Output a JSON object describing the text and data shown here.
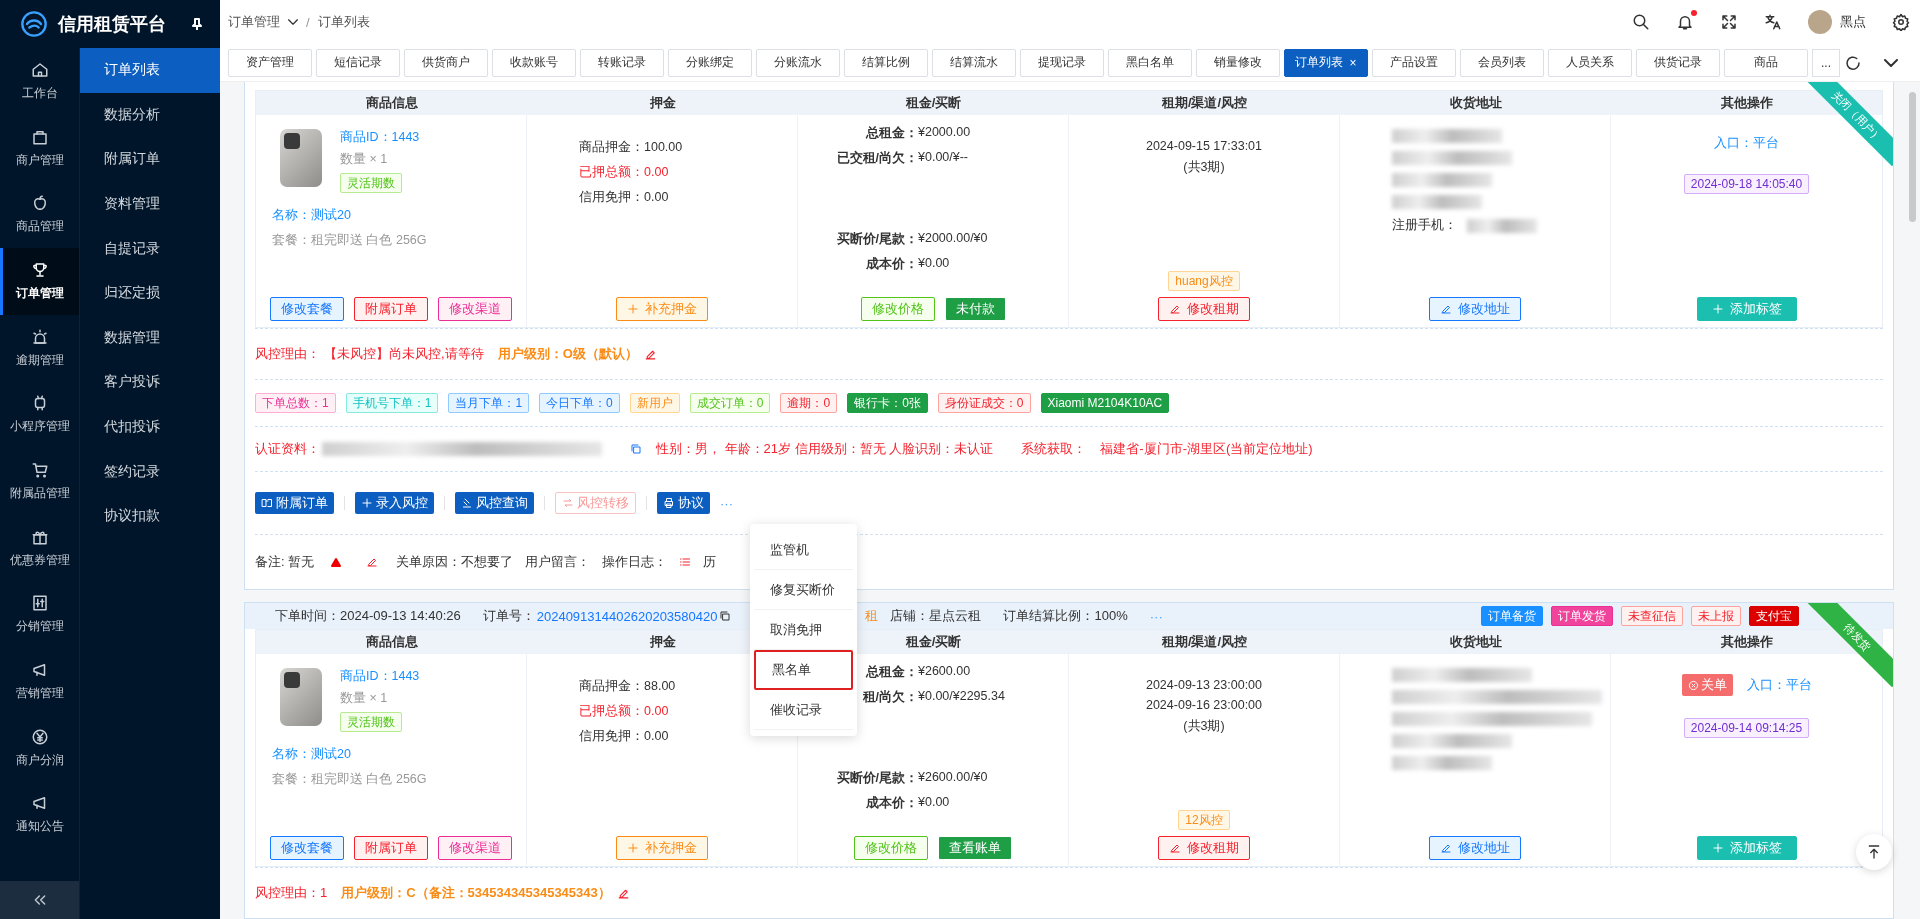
{
  "brand": {
    "title": "信用租赁平台"
  },
  "rail": [
    {
      "label": "工作台",
      "selected": false
    },
    {
      "label": "商户管理",
      "selected": false
    },
    {
      "label": "商品管理",
      "selected": false
    },
    {
      "label": "订单管理",
      "selected": true
    },
    {
      "label": "逾期管理",
      "selected": false
    },
    {
      "label": "小程序管理",
      "selected": false
    },
    {
      "label": "附属品管理",
      "selected": false
    },
    {
      "label": "优惠券管理",
      "selected": false
    },
    {
      "label": "分销管理",
      "selected": false
    },
    {
      "label": "营销管理",
      "selected": false
    },
    {
      "label": "商户分润",
      "selected": false
    },
    {
      "label": "通知公告",
      "selected": false
    }
  ],
  "submenu": [
    {
      "label": "订单列表",
      "selected": true
    },
    {
      "label": "数据分析",
      "selected": false
    },
    {
      "label": "附属订单",
      "selected": false
    },
    {
      "label": "资料管理",
      "selected": false
    },
    {
      "label": "自提记录",
      "selected": false
    },
    {
      "label": "归还定损",
      "selected": false
    },
    {
      "label": "数据管理",
      "selected": false
    },
    {
      "label": "客户投诉",
      "selected": false
    },
    {
      "label": "代扣投诉",
      "selected": false
    },
    {
      "label": "签约记录",
      "selected": false
    },
    {
      "label": "协议扣款",
      "selected": false
    }
  ],
  "breadcrumb": [
    "订单管理",
    "订单列表"
  ],
  "breadcrumb_separator": "/",
  "user": {
    "name": "黑点"
  },
  "tabs": [
    {
      "label": "资产管理",
      "selected": false
    },
    {
      "label": "短信记录",
      "selected": false
    },
    {
      "label": "供货商户",
      "selected": false
    },
    {
      "label": "收款账号",
      "selected": false
    },
    {
      "label": "转账记录",
      "selected": false
    },
    {
      "label": "分账绑定",
      "selected": false
    },
    {
      "label": "分账流水",
      "selected": false
    },
    {
      "label": "结算比例",
      "selected": false
    },
    {
      "label": "结算流水",
      "selected": false
    },
    {
      "label": "提现记录",
      "selected": false
    },
    {
      "label": "黑白名单",
      "selected": false
    },
    {
      "label": "销量修改",
      "selected": false
    },
    {
      "label": "订单列表",
      "selected": true,
      "close": "×"
    },
    {
      "label": "产品设置",
      "selected": false
    },
    {
      "label": "会员列表",
      "selected": false
    },
    {
      "label": "人员关系",
      "selected": false
    },
    {
      "label": "供货记录",
      "selected": false
    },
    {
      "label": "商品",
      "selected": false
    }
  ],
  "tabs_more": "...",
  "orders": [
    {
      "ribbon": {
        "text": "关闭（用户）",
        "color": "#1bbfb0"
      },
      "columns": [
        "商品信息",
        "押金",
        "租金/买断",
        "租期/渠道/风控",
        "收货地址",
        "其他操作"
      ],
      "product": {
        "id": "商品ID：1443",
        "qty": "数量 × 1",
        "tag": "灵活期数",
        "name": "名称：测试20",
        "package": "套餐：租完即送 白色 256G"
      },
      "deposit": [
        {
          "label": "商品押金：",
          "value": "100.00",
          "kind": "normal"
        },
        {
          "label": "已押总额：",
          "value": "0.00",
          "kind": "alert"
        },
        {
          "label": "信用免押：",
          "value": "0.00",
          "kind": "normal"
        }
      ],
      "rent": [
        {
          "label": "总租金：",
          "value": "¥2000.00"
        },
        {
          "label": "已交租/尚欠：",
          "value": "¥0.00/¥--"
        },
        {
          "label": "买断价/尾款：",
          "value": "¥2000.00/¥0"
        },
        {
          "label": "成本价：",
          "value": "¥0.00"
        }
      ],
      "lease": {
        "dates": [
          "2024-09-15 17:33:01"
        ],
        "periods": "(共3期)",
        "risk": "huang风控"
      },
      "address": {
        "phone_label": "注册手机："
      },
      "other": {
        "entry_label": "入口：",
        "entry": "平台",
        "date": "2024-09-18 14:05:40"
      },
      "actions": [
        [
          {
            "label": "修改套餐",
            "kind": "blue"
          },
          {
            "label": "附属订单",
            "kind": "red"
          },
          {
            "label": "修改渠道",
            "kind": "pink"
          }
        ],
        [
          {
            "label": "补充押金",
            "kind": "orange"
          }
        ],
        [
          {
            "label": "修改价格",
            "kind": "green"
          },
          {
            "label": "未付款",
            "kind": "greenfill"
          }
        ],
        [
          {
            "label": "修改租期",
            "kind": "red"
          }
        ],
        [
          {
            "label": "修改地址",
            "kind": "blue"
          }
        ],
        [
          {
            "label": "添加标签",
            "kind": "teal"
          }
        ]
      ],
      "risk": {
        "label": "风控理由：",
        "reason": "【未风控】尚未风控,请等待",
        "level": "用户级别：O级（默认）"
      },
      "stats": [
        {
          "label": "下单总数：1",
          "kind": "pink"
        },
        {
          "label": "手机号下单：1",
          "kind": "teal"
        },
        {
          "label": "当月下单：1",
          "kind": "blue"
        },
        {
          "label": "今日下单：0",
          "kind": "blue"
        },
        {
          "label": "新用户",
          "kind": "orange"
        },
        {
          "label": "成交订单：0",
          "kind": "green"
        },
        {
          "label": "逾期：0",
          "kind": "red"
        },
        {
          "label": "银行卡：0张",
          "kind": "greenfill"
        },
        {
          "label": "身份证成交：0",
          "kind": "red"
        },
        {
          "label": "Xiaomi M2104K10AC",
          "kind": "greenfill"
        }
      ],
      "identity": {
        "label": "认证资料：",
        "info": "性别：男， 年龄：21岁  信用级别：暂无  人脸识别：未认证",
        "sys_label": "系统获取：",
        "location": "福建省-厦门市-湖里区(当前定位地址)"
      },
      "ops": [
        {
          "label": "附属订单",
          "kind": "solid"
        },
        {
          "label": "录入风控",
          "kind": "solid"
        },
        {
          "label": "风控查询",
          "kind": "solid"
        },
        {
          "label": "风控转移",
          "kind": "muted"
        },
        {
          "label": "协议",
          "kind": "solid"
        }
      ],
      "ops_more": "···",
      "remarks": [
        {
          "label": "备注: 暂无"
        },
        {
          "label": "关单原因：不想要了"
        },
        {
          "label": "用户留言："
        },
        {
          "label": "操作日志："
        },
        {
          "label": "历"
        }
      ]
    },
    {
      "ribbon": {
        "text": "待发货",
        "color": "#2fb344"
      },
      "header": {
        "time": "下单时间：2024-09-13 14:40:26",
        "order_label": "订单号：",
        "order_no": "2024091314402620203580420",
        "partial": "租",
        "shop": "店铺：星点云租",
        "ratio": "订单结算比例：100%",
        "more": "···",
        "tags": [
          {
            "label": "订单备货",
            "kind": "bluefill"
          },
          {
            "label": "订单发货",
            "kind": "pinkfill"
          },
          {
            "label": "未查征信",
            "kind": "red"
          },
          {
            "label": "未上报",
            "kind": "red"
          },
          {
            "label": "支付宝",
            "kind": "redfill"
          }
        ]
      },
      "columns": [
        "商品信息",
        "押金",
        "租金/买断",
        "租期/渠道/风控",
        "收货地址",
        "其他操作"
      ],
      "product": {
        "id": "商品ID：1443",
        "qty": "数量 × 1",
        "tag": "灵活期数",
        "name": "名称：测试20",
        "package": "套餐：租完即送 白色 256G"
      },
      "deposit": [
        {
          "label": "商品押金：",
          "value": "88.00",
          "kind": "normal"
        },
        {
          "label": "已押总额：",
          "value": "0.00",
          "kind": "alert"
        },
        {
          "label": "信用免押：",
          "value": "0.00",
          "kind": "normal"
        }
      ],
      "rent": [
        {
          "label": "总租金：",
          "value": "¥2600.00"
        },
        {
          "label": "租/尚欠：",
          "value": "¥0.00/¥2295.34"
        },
        {
          "label": "买断价/尾款：",
          "value": "¥2600.00/¥0"
        },
        {
          "label": "成本价：",
          "value": "¥0.00"
        }
      ],
      "lease": {
        "dates": [
          "2024-09-13 23:00:00",
          "2024-09-16 23:00:00"
        ],
        "periods": "(共3期)",
        "risk": "12风控"
      },
      "other": {
        "close": "关单",
        "entry_label": "入口：",
        "entry": "平台",
        "date": "2024-09-14 09:14:25"
      },
      "actions": [
        [
          {
            "label": "修改套餐",
            "kind": "blue"
          },
          {
            "label": "附属订单",
            "kind": "red"
          },
          {
            "label": "修改渠道",
            "kind": "pink"
          }
        ],
        [
          {
            "label": "补充押金",
            "kind": "orange"
          }
        ],
        [
          {
            "label": "修改价格",
            "kind": "green"
          },
          {
            "label": "查看账单",
            "kind": "greenfill"
          }
        ],
        [
          {
            "label": "修改租期",
            "kind": "red"
          }
        ],
        [
          {
            "label": "修改地址",
            "kind": "blue"
          }
        ],
        [
          {
            "label": "添加标签",
            "kind": "teal"
          }
        ]
      ],
      "risk": {
        "label": "风控理由：1",
        "level": "用户级别：C（备注：534534345345345343）"
      }
    }
  ],
  "menu": [
    {
      "label": "监管机",
      "selected": false
    },
    {
      "label": "修复买断价",
      "selected": false
    },
    {
      "label": "取消免押",
      "selected": false
    },
    {
      "label": "黑名单",
      "selected": true
    },
    {
      "label": "催收记录",
      "selected": false
    }
  ]
}
